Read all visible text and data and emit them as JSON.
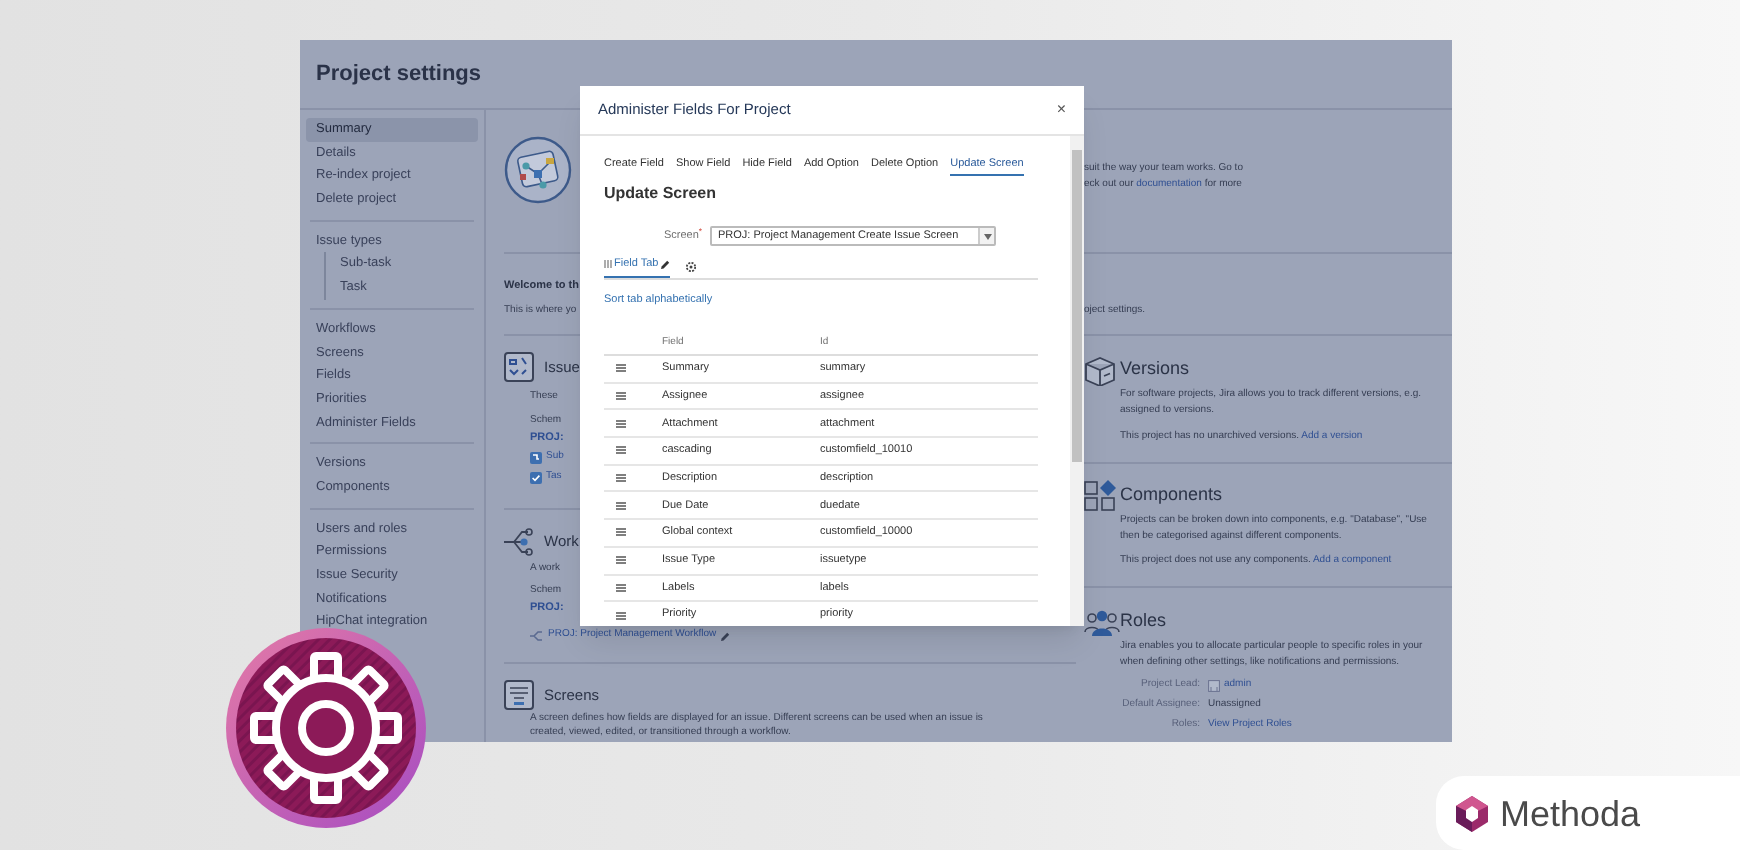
{
  "page_header": {
    "title": "Project settings"
  },
  "sidebar": {
    "groups": [
      {
        "items": [
          {
            "label": "Summary",
            "selected": true
          },
          {
            "label": "Details",
            "selected": false
          },
          {
            "label": "Re-index project",
            "selected": false
          },
          {
            "label": "Delete project",
            "selected": false
          }
        ]
      },
      {
        "items": [
          {
            "label": "Issue types",
            "selected": false,
            "children": [
              {
                "label": "Sub-task",
                "selected": false
              },
              {
                "label": "Task",
                "selected": false
              }
            ]
          }
        ]
      },
      {
        "items": [
          {
            "label": "Workflows",
            "selected": false
          },
          {
            "label": "Screens",
            "selected": false
          },
          {
            "label": "Fields",
            "selected": false
          },
          {
            "label": "Priorities",
            "selected": false
          },
          {
            "label": "Administer Fields",
            "selected": false
          }
        ]
      },
      {
        "items": [
          {
            "label": "Versions",
            "selected": false
          },
          {
            "label": "Components",
            "selected": false
          }
        ]
      },
      {
        "items": [
          {
            "label": "Users and roles",
            "selected": false
          },
          {
            "label": "Permissions",
            "selected": false
          },
          {
            "label": "Issue Security",
            "selected": false
          },
          {
            "label": "Notifications",
            "selected": false
          },
          {
            "label": "HipChat integration",
            "selected": false
          }
        ]
      }
    ]
  },
  "summary": {
    "intro": [
      "suit the way your team works. Go to",
      {
        "before": "eck out our",
        "link": "documentation",
        "after": "for more"
      }
    ],
    "welcome_title": "Welcome to th",
    "welcome_text": "This is where yo",
    "welcome_text_end": "oject settings."
  },
  "issue_types": {
    "title": "Issue",
    "description": "These",
    "scheme_label": "Schem",
    "scheme": "PROJ:",
    "types": [
      {
        "kind": "subtask",
        "label": "Sub"
      },
      {
        "kind": "task",
        "label": "Tas"
      }
    ]
  },
  "workflows": {
    "title": "Work",
    "description": "A work",
    "scheme_label": "Schem",
    "scheme": "PROJ:",
    "workflow": "PROJ: Project Management Workflow"
  },
  "screens": {
    "title": "Screens",
    "description": [
      "A screen defines how fields are displayed for an issue. Different screens can be used when an issue is",
      "created, viewed, edited, or transitioned through a workflow."
    ]
  },
  "versions": {
    "title": "Versions",
    "description": [
      "For software projects, Jira allows you to track different versions, e.g.",
      "assigned to versions."
    ],
    "status": "This project has no unarchived versions.",
    "action": "Add a version"
  },
  "components": {
    "title": "Components",
    "description": [
      "Projects can be broken down into components, e.g. \"Database\", \"Use",
      "then be categorised against different components."
    ],
    "status": "This project does not use any components.",
    "action": "Add a component"
  },
  "roles": {
    "title": "Roles",
    "description": [
      "Jira enables you to allocate particular people to specific roles in your",
      "when defining other settings, like notifications and permissions."
    ],
    "details": [
      {
        "label": "Project Lead:",
        "value": "admin",
        "kind": "user"
      },
      {
        "label": "Default Assignee:",
        "value": "Unassigned",
        "kind": "text"
      },
      {
        "label": "Roles:",
        "value": "View Project Roles",
        "kind": "link"
      }
    ]
  },
  "modal": {
    "title": "Administer Fields For Project",
    "close": "×",
    "tabs": [
      {
        "label": "Create Field",
        "selected": false
      },
      {
        "label": "Show Field",
        "selected": false
      },
      {
        "label": "Hide Field",
        "selected": false
      },
      {
        "label": "Add Option",
        "selected": false
      },
      {
        "label": "Delete Option",
        "selected": false
      },
      {
        "label": "Update Screen",
        "selected": true
      }
    ],
    "heading": "Update Screen",
    "screen_label": "Screen",
    "required_mark": "*",
    "screen_value": "PROJ: Project Management Create Issue Screen",
    "field_tabs": [
      {
        "label": "Field Tab",
        "selected": true
      }
    ],
    "sort_link": "Sort tab alphabetically",
    "columns": [
      "Field",
      "Id"
    ],
    "rows": [
      {
        "field": "Summary",
        "id": "summary"
      },
      {
        "field": "Assignee",
        "id": "assignee"
      },
      {
        "field": "Attachment",
        "id": "attachment"
      },
      {
        "field": "cascading",
        "id": "customfield_10010"
      },
      {
        "field": "Description",
        "id": "description"
      },
      {
        "field": "Due Date",
        "id": "duedate"
      },
      {
        "field": "Global context",
        "id": "customfield_10000"
      },
      {
        "field": "Issue Type",
        "id": "issuetype"
      },
      {
        "field": "Labels",
        "id": "labels"
      },
      {
        "field": "Priority",
        "id": "priority"
      }
    ]
  },
  "brand": {
    "name": "Methoda"
  }
}
